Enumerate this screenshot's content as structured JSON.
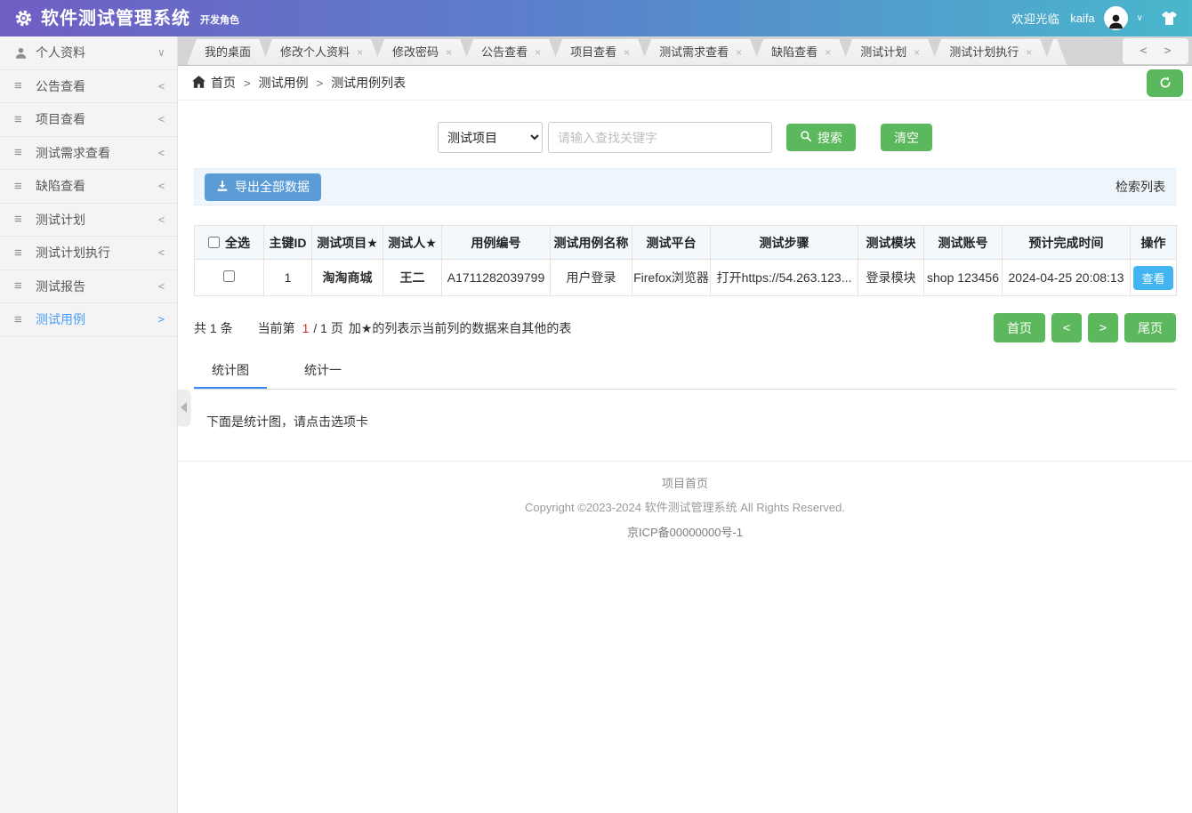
{
  "header": {
    "title": "软件测试管理系统",
    "role": "开发角色",
    "welcome": "欢迎光临",
    "username": "kaifa",
    "caret": "∨"
  },
  "sidebar": {
    "items": [
      {
        "label": "个人资料",
        "chevron": "∨"
      },
      {
        "label": "公告查看",
        "chevron": "<"
      },
      {
        "label": "项目查看",
        "chevron": "<"
      },
      {
        "label": "测试需求查看",
        "chevron": "<"
      },
      {
        "label": "缺陷查看",
        "chevron": "<"
      },
      {
        "label": "测试计划",
        "chevron": "<"
      },
      {
        "label": "测试计划执行",
        "chevron": "<"
      },
      {
        "label": "测试报告",
        "chevron": "<"
      },
      {
        "label": "测试用例",
        "chevron": ">"
      }
    ]
  },
  "tabs": {
    "items": [
      {
        "label": "我的桌面"
      },
      {
        "label": "修改个人资料"
      },
      {
        "label": "修改密码"
      },
      {
        "label": "公告查看"
      },
      {
        "label": "项目查看"
      },
      {
        "label": "测试需求查看"
      },
      {
        "label": "缺陷查看"
      },
      {
        "label": "测试计划"
      },
      {
        "label": "测试计划执行"
      }
    ],
    "close_glyph": "×",
    "scroll_left": "<",
    "scroll_right": ">"
  },
  "breadcrumb": {
    "home": "首页",
    "sep": ">",
    "level1": "测试用例",
    "level2": "测试用例列表"
  },
  "search": {
    "filter_value": "测试项目",
    "placeholder": "请输入查找关键字",
    "search_label": "搜索",
    "clear_label": "清空"
  },
  "toolbar": {
    "export_label": "导出全部数据",
    "list_label": "检索列表"
  },
  "table": {
    "headers": [
      "全选",
      "主键ID",
      "测试项目★",
      "测试人★",
      "用例编号",
      "测试用例名称",
      "测试平台",
      "测试步骤",
      "测试模块",
      "测试账号",
      "预计完成时间",
      "操作"
    ],
    "rows": [
      {
        "id": "1",
        "project": "淘淘商城",
        "tester": "王二",
        "case_no": "A1711282039799",
        "case_name": "用户登录",
        "platform": "Firefox浏览器",
        "steps": "打开https://54.263.123...",
        "module": "登录模块",
        "account": "shop 123456",
        "due": "2024-04-25 20:08:13",
        "action": "查看"
      }
    ]
  },
  "pagination": {
    "total_text": "共 1 条",
    "current_prefix": "当前第",
    "current_page": "1",
    "page_suffix": "/ 1 页",
    "note": "加★的列表示当前列的数据来自其他的表",
    "first": "首页",
    "prev": "<",
    "next": ">",
    "last": "尾页"
  },
  "stats": {
    "tab1": "统计图",
    "tab2": "统计一",
    "hint": "下面是统计图，请点击选项卡"
  },
  "footer": {
    "line1": "项目首页",
    "line2": "Copyright ©2023-2024 软件测试管理系统 All Rights Reserved.",
    "line3": "京ICP备00000000号-1"
  },
  "colors": {
    "header_gradient_start": "#6f5ec4",
    "header_gradient_end": "#49b7cc",
    "green_button": "#5cb85c",
    "blue_button": "#5b9cd6",
    "sky_button": "#42b4f0",
    "red_text": "#c12e2a",
    "active_tab_underline": "#3d8af2",
    "sidebar_active": "#459df5"
  }
}
